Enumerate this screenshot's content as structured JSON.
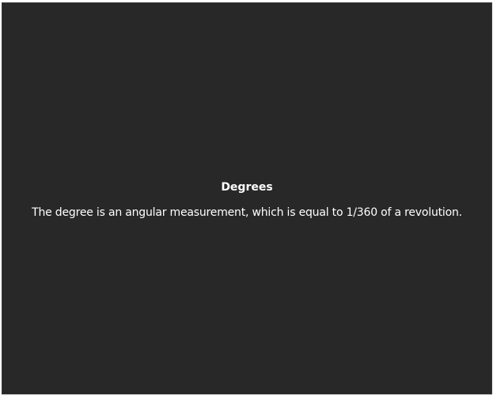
{
  "panel": {
    "title": "Degrees",
    "description": "The degree is an angular measurement, which is equal to 1/360 of a revolution."
  }
}
